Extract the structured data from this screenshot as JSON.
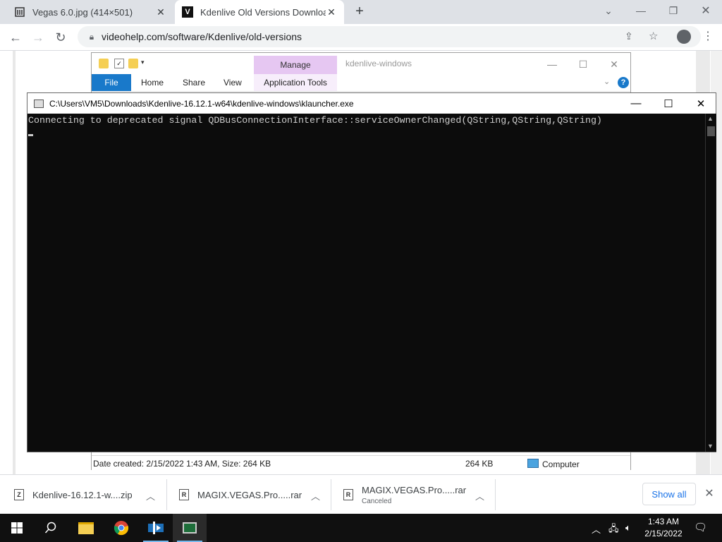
{
  "browser": {
    "tabs": [
      {
        "title": "Vegas 6.0.jpg (414×501)",
        "favicon": "image-viewer-icon"
      },
      {
        "title": "Kdenlive Old Versions Download",
        "favicon": "videohelp-icon"
      }
    ],
    "new_tab": "+",
    "url": "videohelp.com/software/Kdenlive/old-versions"
  },
  "explorer": {
    "title": "kdenlive-windows",
    "manage_label": "Manage",
    "ribbon_tabs": [
      "File",
      "Home",
      "Share",
      "View",
      "Application Tools"
    ],
    "status": {
      "details": "Date created: 2/15/2022 1:43 AM, Size: 264 KB",
      "size": "264 KB",
      "location": "Computer"
    }
  },
  "console": {
    "title": "C:\\Users\\VM5\\Downloads\\Kdenlive-16.12.1-w64\\kdenlive-windows\\klauncher.exe",
    "output": "Connecting to deprecated signal QDBusConnectionInterface::serviceOwnerChanged(QString,QString,QString)"
  },
  "downloads": {
    "items": [
      {
        "name": "Kdenlive-16.12.1-w....zip",
        "icon": "zip-file-icon",
        "status": ""
      },
      {
        "name": "MAGIX.VEGAS.Pro.....rar",
        "icon": "rar-file-icon",
        "status": ""
      },
      {
        "name": "MAGIX.VEGAS.Pro.....rar",
        "icon": "rar-file-icon",
        "status": "Canceled"
      }
    ],
    "show_all": "Show all"
  },
  "taskbar": {
    "time": "1:43 AM",
    "date": "2/15/2022"
  }
}
